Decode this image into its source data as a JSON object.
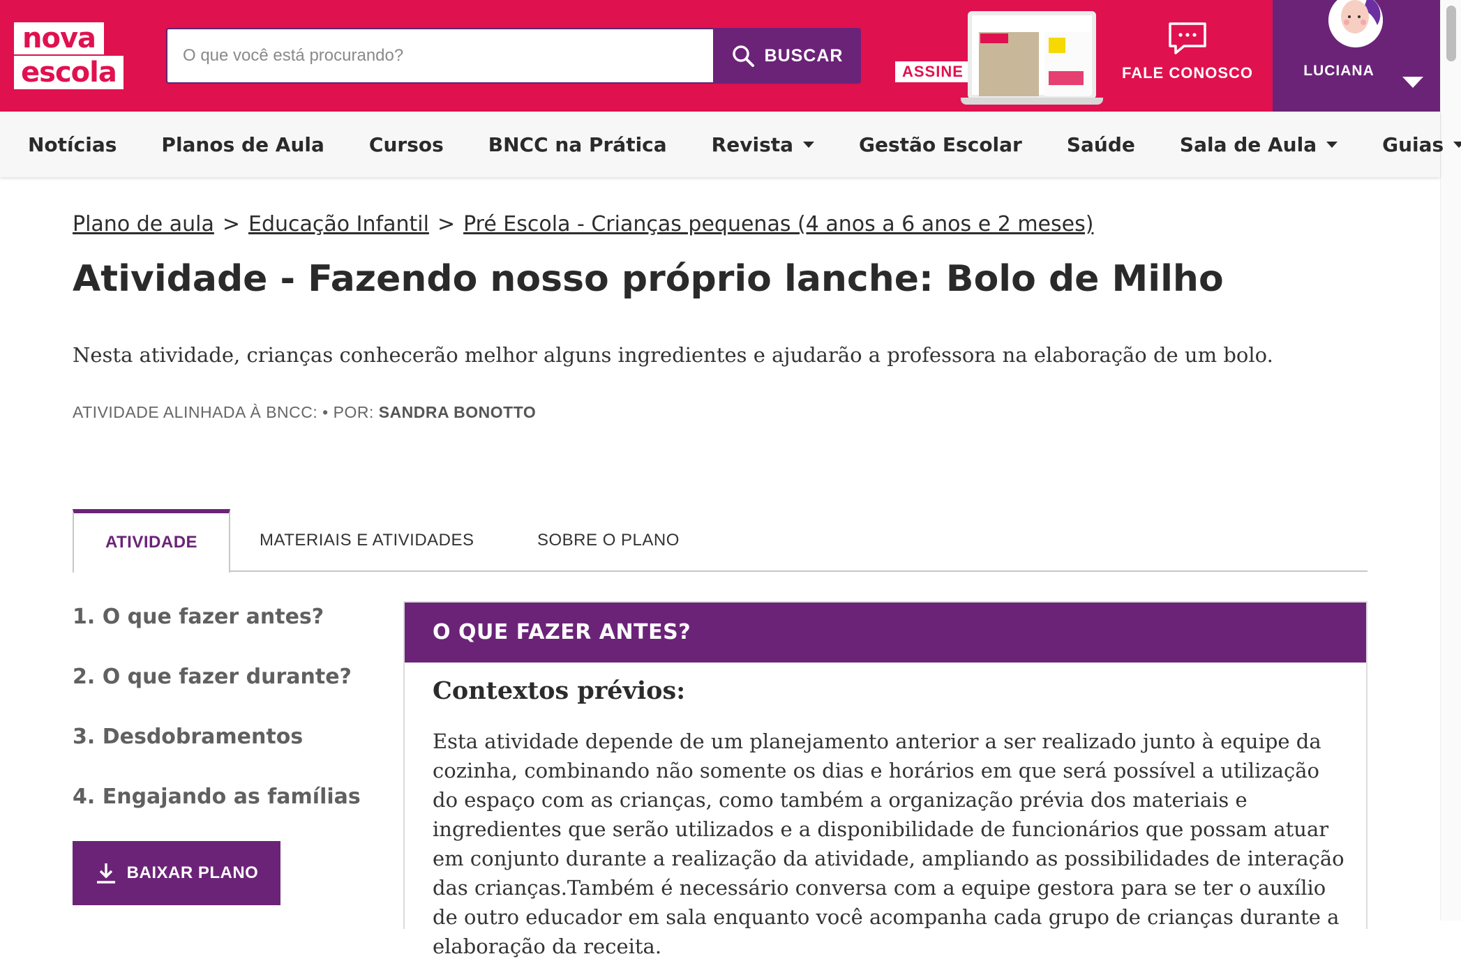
{
  "header": {
    "logo_line1": "nova",
    "logo_line2": "escola",
    "search_placeholder": "O que você está procurando?",
    "search_button": "BUSCAR",
    "subscribe_label": "ASSINE",
    "contact_label": "FALE CONOSCO",
    "user_name": "LUCIANA"
  },
  "nav": {
    "items": [
      {
        "label": "Notícias",
        "dropdown": false
      },
      {
        "label": "Planos de Aula",
        "dropdown": false
      },
      {
        "label": "Cursos",
        "dropdown": false
      },
      {
        "label": "BNCC na Prática",
        "dropdown": false
      },
      {
        "label": "Revista",
        "dropdown": true
      },
      {
        "label": "Gestão Escolar",
        "dropdown": false
      },
      {
        "label": "Saúde",
        "dropdown": false
      },
      {
        "label": "Sala de Aula",
        "dropdown": true
      },
      {
        "label": "Guias",
        "dropdown": true
      }
    ]
  },
  "breadcrumb": {
    "items": [
      "Plano de aula",
      "Educação Infantil",
      "Pré Escola - Crianças pequenas (4 anos a 6 anos e 2 meses)"
    ],
    "separator": ">"
  },
  "page": {
    "title": "Atividade - Fazendo nosso próprio lanche: Bolo de Milho",
    "description": "Nesta atividade, crianças conhecerão melhor alguns ingredientes e ajudarão a professora na elaboração de um bolo.",
    "meta_prefix": "ATIVIDADE ALINHADA À BNCC: • POR:",
    "author": "SANDRA BONOTTO"
  },
  "tabs": [
    "ATIVIDADE",
    "MATERIAIS E ATIVIDADES",
    "SOBRE O PLANO"
  ],
  "sidebar": {
    "items": [
      "1. O que fazer antes?",
      "2. O que fazer durante?",
      "3. Desdobramentos",
      "4. Engajando as famílias"
    ],
    "download_label": "BAIXAR PLANO"
  },
  "panel": {
    "heading": "O QUE FAZER ANTES?",
    "subheading": "Contextos prévios:",
    "body": "Esta atividade depende de um planejamento anterior a ser realizado junto à equipe da cozinha, combinando não somente os dias e horários em que será possível a utilização do espaço com as crianças, como também a organização prévia dos materiais e ingredientes que serão utilizados e a disponibilidade de funcionários que possam atuar em conjunto durante a realização da atividade, ampliando as possibilidades de interação das crianças.Também é necessário conversa com a equipe gestora para se ter o auxílio de outro educador em sala enquanto você acompanha cada grupo de crianças durante a elaboração da receita."
  },
  "colors": {
    "brand_pink": "#e0114f",
    "brand_purple": "#6b2378"
  }
}
